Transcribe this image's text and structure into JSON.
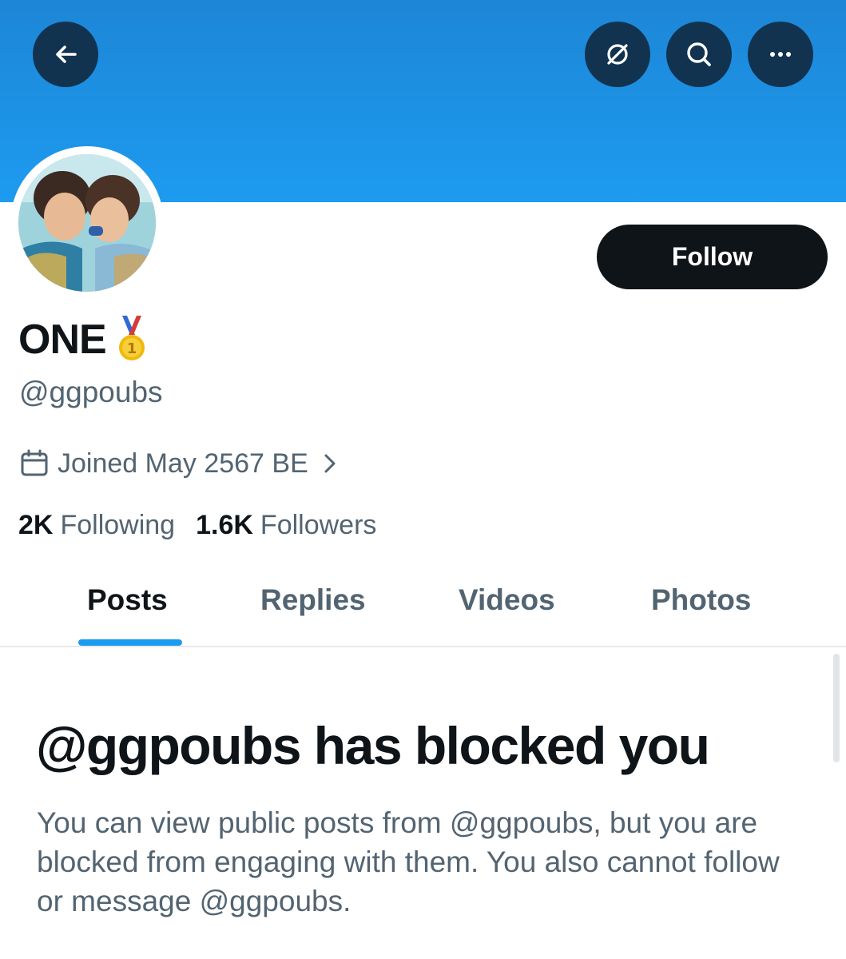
{
  "header": {
    "back_icon": "arrow-left-icon",
    "grok_icon": "grok-slash-circle-icon",
    "search_icon": "search-icon",
    "more_icon": "more-horizontal-icon",
    "banner_color": "#1d9bf0",
    "button_color": "#12334f"
  },
  "profile": {
    "display_name": "ONE",
    "badge_icon": "gold-medal-icon",
    "handle": "@ggpoubs",
    "joined": "Joined May 2567 BE",
    "follow_label": "Follow"
  },
  "stats": {
    "following_count": "2K",
    "following_label": "Following",
    "followers_count": "1.6K",
    "followers_label": "Followers"
  },
  "tabs": [
    {
      "label": "Posts",
      "active": true
    },
    {
      "label": "Replies",
      "active": false
    },
    {
      "label": "Videos",
      "active": false
    },
    {
      "label": "Photos",
      "active": false
    }
  ],
  "blocked": {
    "title": "@ggpoubs has blocked you",
    "description": "You can view public posts from @ggpoubs, but you are blocked from engaging with them. You also cannot follow or message @ggpoubs."
  },
  "colors": {
    "accent": "#1d9bf0",
    "text_primary": "#0f1419",
    "text_secondary": "#536471"
  }
}
